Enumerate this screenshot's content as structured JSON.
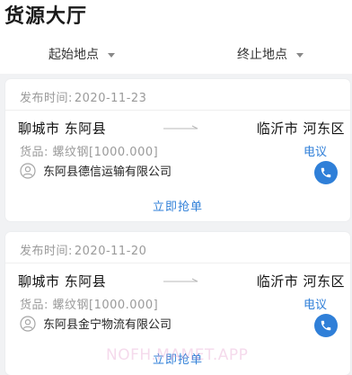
{
  "header": {
    "title": "货源大厅",
    "filter_start": "起始地点",
    "filter_end": "终止地点"
  },
  "listings": [
    {
      "publish_label": "发布时间:",
      "publish_date": "2020-11-23",
      "from": "聊城市 东阿县",
      "to": "临沂市 河东区",
      "goods": "货品: 螺纹钢[1000.000]",
      "price": "电议",
      "company": "东阿县德信运输有限公司",
      "action": "立即抢单"
    },
    {
      "publish_label": "发布时间:",
      "publish_date": "2020-11-20",
      "from": "聊城市 东阿县",
      "to": "临沂市 河东区",
      "goods": "货品: 螺纹钢[1000.000]",
      "price": "电议",
      "company": "东阿县金宁物流有限公司",
      "action": "立即抢单"
    }
  ],
  "watermark": "NOFH.MAMET.APP",
  "colors": {
    "accent": "#2f7fd8",
    "muted": "#9a9a9a",
    "background": "#f1f2f4"
  },
  "icons": {
    "avatar": "user-avatar-icon",
    "phone": "phone-icon",
    "caret": "caret-down-icon",
    "arrow": "route-arrow-icon"
  }
}
